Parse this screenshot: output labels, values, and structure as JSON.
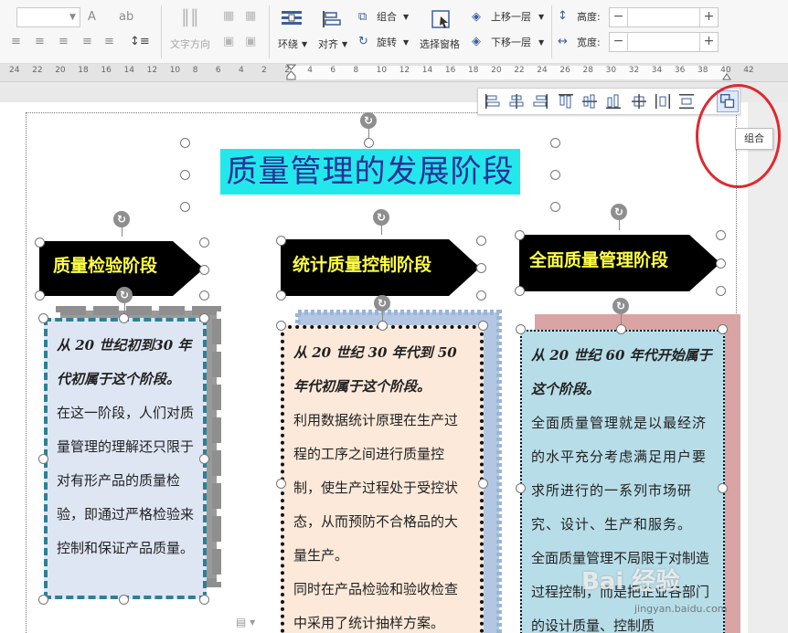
{
  "ribbon": {
    "text_direction": "文字方向",
    "wrap": "环绕",
    "align": "对齐",
    "group": "组合",
    "rotate": "旋转",
    "selection_pane": "选择窗格",
    "bring_forward": "上移一层",
    "send_backward": "下移一层",
    "height_label": "高度:",
    "width_label": "宽度:",
    "height_value": "",
    "width_value": "",
    "minus": "−",
    "plus": "+"
  },
  "ruler": {
    "ticks": [
      "24",
      "22",
      "20",
      "18",
      "16",
      "14",
      "12",
      "10",
      "8",
      "6",
      "4",
      "2",
      "2",
      "4",
      "6",
      "8",
      "10",
      "12",
      "14",
      "16",
      "18",
      "20",
      "22",
      "24",
      "26",
      "28",
      "30",
      "32",
      "34",
      "36",
      "38",
      "40",
      "42"
    ]
  },
  "tooltip": "组合",
  "title": "质量管理的发展阶段",
  "stages": [
    {
      "heading": "质量检验阶段",
      "lead": "从 20 世纪初到30 年代初属于这个阶段。",
      "body": "在这一阶段，人们对质量管理的理解还只限于对有形产品的质量检验，即通过严格检验来控制和保证产品质量。"
    },
    {
      "heading": "统计质量控制阶段",
      "lead": "从 20 世纪 30 年代到 50 年代初属于这个阶段。",
      "body": "利用数据统计原理在生产过程的工序之间进行质量控制，使生产过程处于受控状态，从而预防不合格品的大量生产。",
      "body2": "同时在产品检验和验收检查中采用了统计抽样方案。"
    },
    {
      "heading": "全面质量管理阶段",
      "lead": "从 20 世纪 60 年代开始属于这个阶段。",
      "body": "全面质量管理就是以最经济的水平充分考虑满足用户要求所进行的一系列市场研究、设计、生产和服务。",
      "body2": "全面质量管理不局限于对制造过程控制，而是把企业各部门的设计质量、控制质"
    }
  ],
  "colors": {
    "title_bg": "#22e8ec",
    "title_text": "#2b2f96",
    "banner_bg": "#000000",
    "banner_text": "#ffff44",
    "box1_bg": "#dfe6f3",
    "box2_bg": "#fce9da",
    "box3_bg": "#b7dde8",
    "highlight": "#e0282e"
  },
  "watermark": {
    "brand": "Bai 经验",
    "url": "jingyan.baidu.com"
  }
}
